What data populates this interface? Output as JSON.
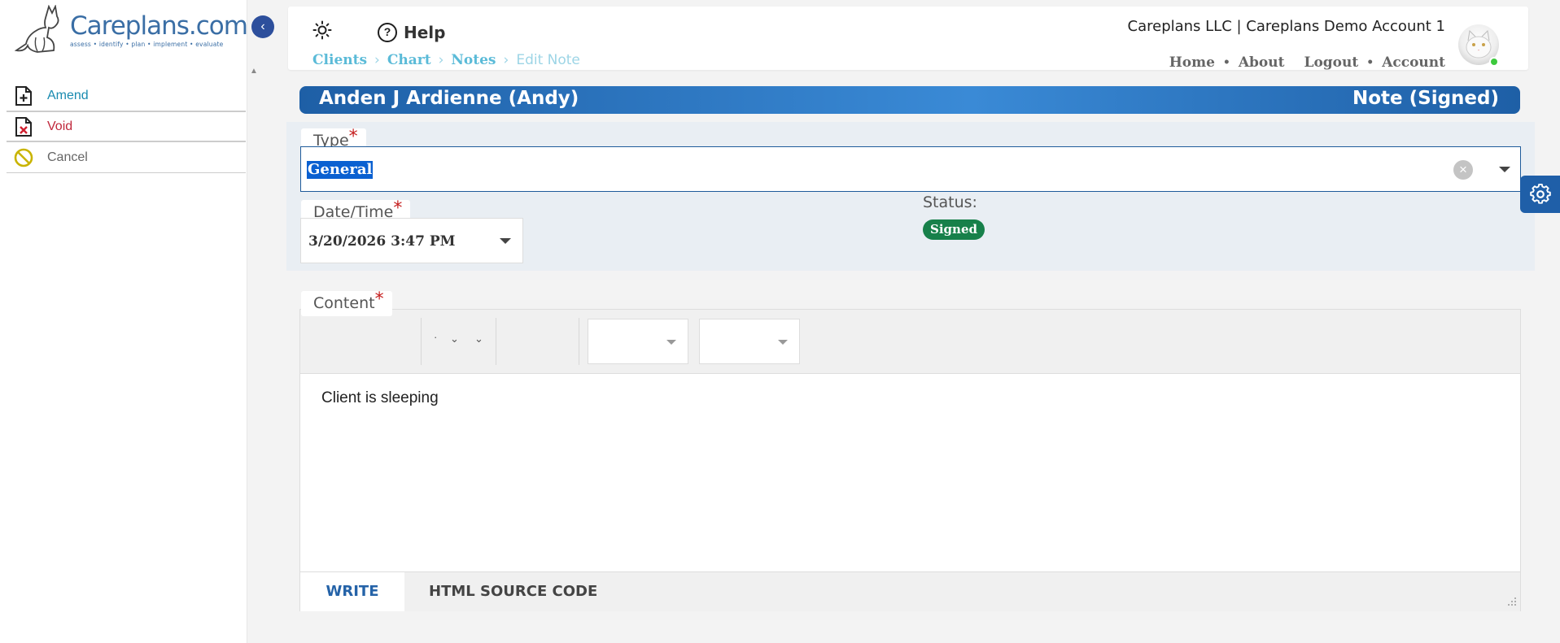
{
  "logo": {
    "brand": "Careplans.com",
    "tagline": "assess • identify • plan • implement • evaluate"
  },
  "sidebar": {
    "items": [
      {
        "label": "Amend",
        "icon": "file-plus-icon",
        "color": "#1a8bb0"
      },
      {
        "label": "Void",
        "icon": "file-x-icon",
        "color": "#c0283c"
      },
      {
        "label": "Cancel",
        "icon": "ban-icon",
        "color": "#666666"
      }
    ]
  },
  "topbar": {
    "help_label": "Help",
    "breadcrumbs": [
      "Clients",
      "Chart",
      "Notes",
      "Edit Note"
    ],
    "account_name": "Careplans LLC | Careplans Demo Account 1",
    "links": [
      "Home",
      "About",
      "Logout",
      "Account"
    ]
  },
  "header": {
    "client_name": "Anden J Ardienne (Andy)",
    "note_status": "Note (Signed)"
  },
  "form": {
    "type_label": "Type",
    "type_value": "General",
    "datetime_label": "Date/Time",
    "datetime_value": "3/20/2026 3:47 PM",
    "status_label": "Status:",
    "status_value": "Signed",
    "content_label": "Content",
    "content_text": "Client is sleeping",
    "required_mark": "*"
  },
  "editor": {
    "tabs": [
      {
        "label": "WRITE",
        "active": true
      },
      {
        "label": "HTML SOURCE CODE",
        "active": false
      }
    ]
  },
  "colors": {
    "accent": "#1e5fa6",
    "status_green": "#17804a",
    "breadcrumb": "#5bbbd8"
  }
}
